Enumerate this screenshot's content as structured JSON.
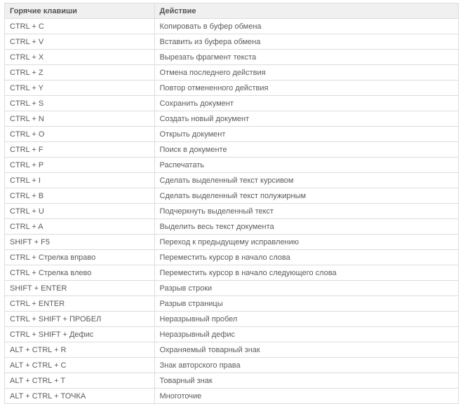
{
  "chart_data": {
    "type": "table",
    "columns": [
      "Горячие клавиши",
      "Действие"
    ],
    "rows": [
      [
        "CTRL + C",
        "Копировать в буфер обмена"
      ],
      [
        "CTRL + V",
        "Вставить из буфера обмена"
      ],
      [
        "CTRL + X",
        "Вырезать фрагмент текста"
      ],
      [
        "CTRL + Z",
        "Отмена последнего действия"
      ],
      [
        "CTRL + Y",
        "Повтор отмененного действия"
      ],
      [
        "CTRL + S",
        "Сохранить документ"
      ],
      [
        "CTRL + N",
        "Создать новый документ"
      ],
      [
        "CTRL + O",
        "Открыть документ"
      ],
      [
        "CTRL + F",
        "Поиск в документе"
      ],
      [
        "CTRL + P",
        "Распечатать"
      ],
      [
        "CTRL + I",
        "Сделать выделенный текст курсивом"
      ],
      [
        "CTRL + B",
        "Сделать выделенный текст полужирным"
      ],
      [
        "CTRL + U",
        "Подчеркнуть выделенный текст"
      ],
      [
        "CTRL + A",
        "Выделить весь текст документа"
      ],
      [
        "SHIFT + F5",
        "Переход к предыдущему исправлению"
      ],
      [
        "CTRL + Стрелка вправо",
        "Переместить курсор в начало слова"
      ],
      [
        "CTRL + Стрелка влево",
        "Переместить курсор в начало следующего слова"
      ],
      [
        "SHIFT + ENTER",
        "Разрыв строки"
      ],
      [
        "CTRL + ENTER",
        "Разрыв страницы"
      ],
      [
        "CTRL + SHIFT + ПРОБЕЛ",
        "Неразрывный пробел"
      ],
      [
        "CTRL + SHIFT + Дефис",
        "Неразрывный дефис"
      ],
      [
        "ALT + CTRL + R",
        "Охраняемый товарный знак"
      ],
      [
        "ALT + CTRL + C",
        "Знак авторского права"
      ],
      [
        "ALT + CTRL + T",
        "Товарный знак"
      ],
      [
        "ALT + CTRL + ТОЧКА",
        "Многоточие"
      ]
    ]
  }
}
